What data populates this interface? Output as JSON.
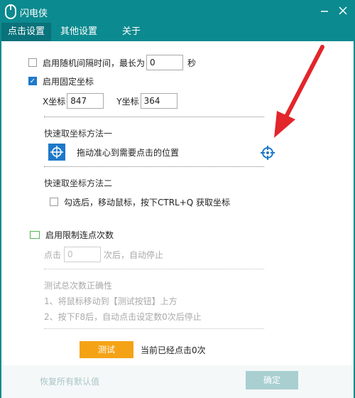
{
  "app": {
    "title": "闪电侠"
  },
  "tabs": [
    {
      "label": "点击设置",
      "active": true
    },
    {
      "label": "其他设置",
      "active": false
    },
    {
      "label": "关于",
      "active": false
    }
  ],
  "random_interval": {
    "label": "启用随机间隔时间，最长为",
    "value": "0",
    "unit": "秒",
    "checked": false
  },
  "fixed_coord": {
    "label": "启用固定坐标",
    "checked": true,
    "x_label": "X坐标",
    "x_value": "847",
    "y_label": "Y坐标",
    "y_value": "364"
  },
  "method1": {
    "title": "快速取坐标方法一",
    "instruction": "拖动准心到需要点击的位置"
  },
  "method2": {
    "title": "快速取坐标方法二",
    "label": "勾选后，移动鼠标，按下CTRL+Q 获取坐标",
    "checked": false
  },
  "limit": {
    "label": "启用限制连点次数",
    "checked": false,
    "prefix": "点击",
    "value": "0",
    "suffix": "次后，自动停止"
  },
  "test": {
    "title": "测试总次数正确性",
    "step1": "1、将鼠标移动到【测试按钮】上方",
    "step2": "2、按下F8后，自动点击设定数0次后停止",
    "button": "测试",
    "status": "当前已经点击0次"
  },
  "footer": {
    "restore_label": "恢复所有默认值",
    "ok_label": "确定"
  },
  "colors": {
    "titlebar": "#0b8a8f",
    "accent_orange": "#f5a316",
    "arrow_red": "#e2262a",
    "crosshair_blue": "#1e79c9"
  },
  "icons": {
    "app": "mouse-icon",
    "target": "crosshair-icon",
    "annotation": "red-arrow-icon"
  }
}
